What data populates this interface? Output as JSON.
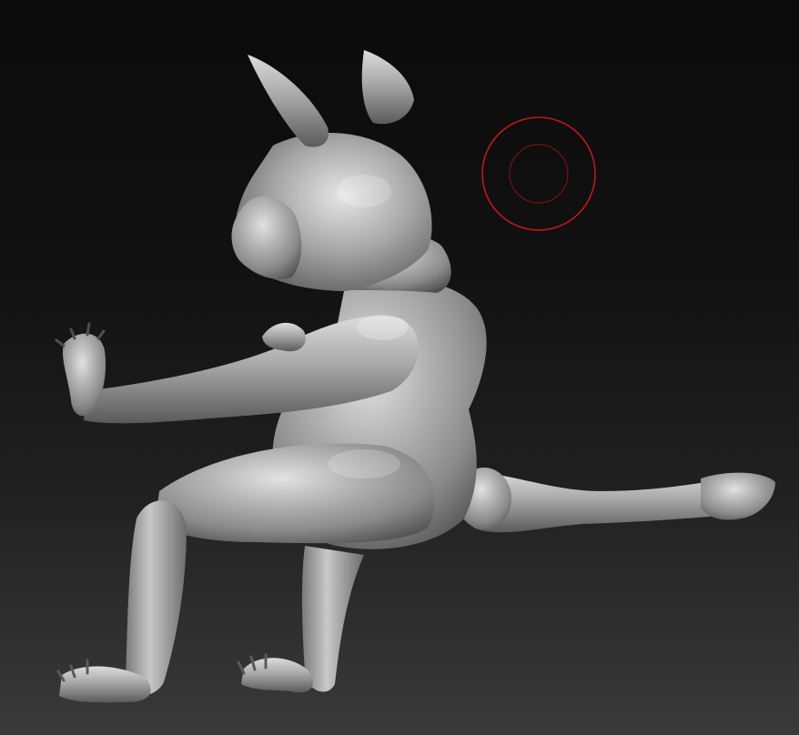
{
  "canvas": {
    "background_top": "#0b0b0b",
    "background_bottom": "#3a3a3a",
    "model_color": "#9a9a9a",
    "model_highlight": "#e8e8e8",
    "model_shadow": "#4a4a4a"
  },
  "brush_cursor": {
    "color": "#c01818",
    "icon": "brush-cursor-icon"
  },
  "model": {
    "icon": "sculpted-creature-mesh"
  }
}
